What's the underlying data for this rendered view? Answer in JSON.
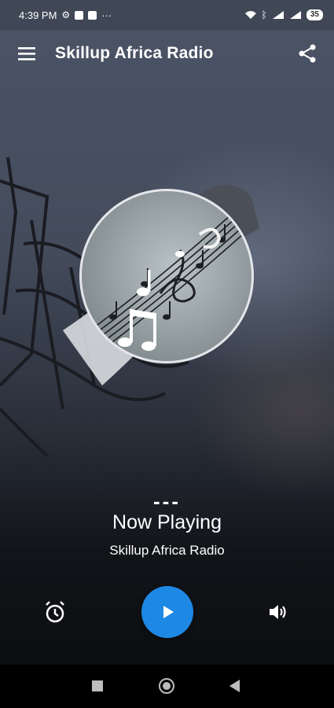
{
  "status_bar": {
    "time": "4:39 PM",
    "dots": "···",
    "battery": "35",
    "icons": [
      "gear-icon",
      "b-icon",
      "news-icon",
      "wifi-icon",
      "bluetooth-icon",
      "signal-icon",
      "signal-icon",
      "battery-icon"
    ]
  },
  "app_bar": {
    "title": "Skillup Africa Radio",
    "menu_icon": "hamburger-menu-icon",
    "share_icon": "share-icon"
  },
  "player": {
    "track_title": "---",
    "status": "Now Playing",
    "station": "Skillup Africa Radio"
  },
  "controls": {
    "alarm_icon": "alarm-clock-icon",
    "play_icon": "play-icon",
    "volume_icon": "volume-icon"
  },
  "colors": {
    "accent": "#1e88e5",
    "text": "#ffffff",
    "nav_bar": "#000000"
  },
  "system_nav": [
    "recents-button",
    "home-button",
    "back-button"
  ]
}
